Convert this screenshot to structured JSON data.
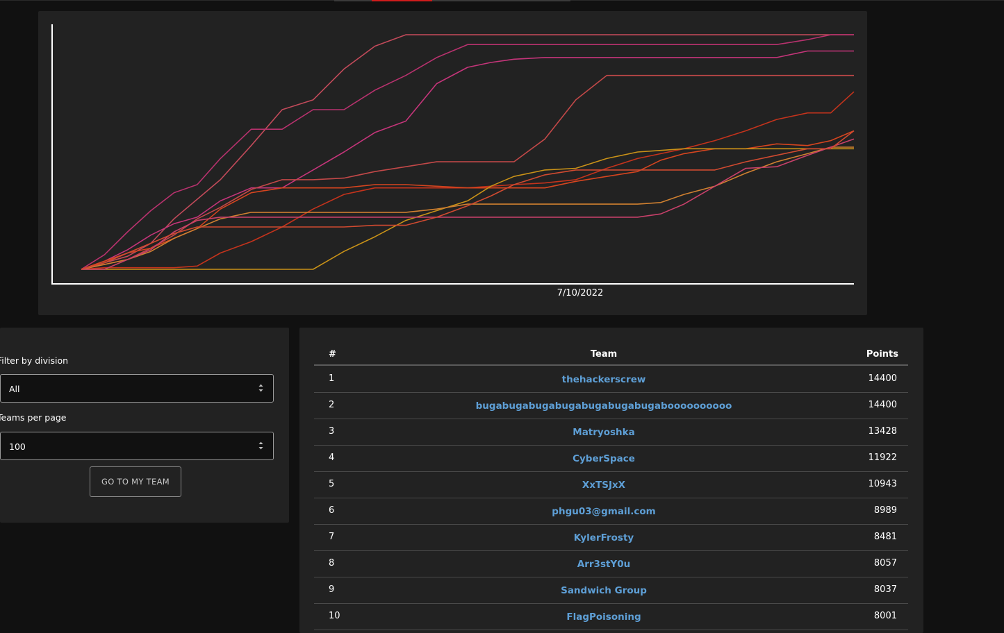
{
  "chart_data": {
    "type": "line",
    "x_tick_labels": [
      "7/10/2022"
    ],
    "series": [
      {
        "color": "#c24a5a",
        "x": [
          0,
          3,
          6,
          9,
          12,
          15,
          18,
          22,
          26,
          30,
          34,
          38,
          42,
          46,
          50,
          53,
          56,
          60,
          64,
          68,
          72,
          75,
          78,
          82,
          86,
          90,
          94,
          97,
          100
        ],
        "y": [
          0,
          0.4,
          0.8,
          1.6,
          3.1,
          4.3,
          5.5,
          7.6,
          9.8,
          10.4,
          12.3,
          13.7,
          14.4,
          14.4,
          14.4,
          14.4,
          14.4,
          14.4,
          14.4,
          14.4,
          14.4,
          14.4,
          14.4,
          14.4,
          14.4,
          14.4,
          14.4,
          14.4,
          14.4
        ]
      },
      {
        "color": "#b8326e",
        "x": [
          0,
          3,
          6,
          9,
          12,
          15,
          18,
          22,
          26,
          30,
          34,
          38,
          42,
          46,
          50,
          53,
          56,
          60,
          64,
          68,
          72,
          75,
          78,
          82,
          86,
          90,
          94,
          97,
          100
        ],
        "y": [
          0,
          0.9,
          2.3,
          3.6,
          4.7,
          5.2,
          6.8,
          8.6,
          8.6,
          9.8,
          9.8,
          11.0,
          11.9,
          13.0,
          13.8,
          13.8,
          13.8,
          13.8,
          13.8,
          13.8,
          13.8,
          13.8,
          13.8,
          13.8,
          13.8,
          13.8,
          14.1,
          14.4,
          14.4
        ]
      },
      {
        "color": "#c5357a",
        "x": [
          0,
          3,
          6,
          9,
          12,
          15,
          18,
          22,
          26,
          30,
          34,
          38,
          42,
          46,
          50,
          53,
          56,
          60,
          64,
          68,
          72,
          75,
          78,
          82,
          86,
          90,
          94,
          97,
          100
        ],
        "y": [
          0,
          0.5,
          1.2,
          2.1,
          2.8,
          3.2,
          4.2,
          5.0,
          5.0,
          6.1,
          7.2,
          8.4,
          9.1,
          11.4,
          12.4,
          12.7,
          12.9,
          13.0,
          13.0,
          13.0,
          13.0,
          13.0,
          13.0,
          13.0,
          13.0,
          13.0,
          13.4,
          13.4,
          13.4
        ]
      },
      {
        "color": "#c24848",
        "x": [
          0,
          3,
          6,
          9,
          12,
          15,
          18,
          22,
          26,
          30,
          34,
          38,
          42,
          46,
          50,
          53,
          56,
          60,
          64,
          68,
          72,
          75,
          78,
          82,
          86,
          90,
          94,
          97,
          100
        ],
        "y": [
          0,
          0.3,
          0.6,
          1.3,
          2.1,
          3.1,
          3.8,
          4.9,
          5.5,
          5.5,
          5.6,
          6.0,
          6.3,
          6.6,
          6.6,
          6.6,
          6.6,
          8.0,
          10.4,
          11.9,
          11.9,
          11.9,
          11.9,
          11.9,
          11.9,
          11.9,
          11.9,
          11.9,
          11.9
        ]
      },
      {
        "color": "#c4331c",
        "x": [
          0,
          3,
          6,
          9,
          12,
          15,
          18,
          22,
          26,
          30,
          34,
          38,
          42,
          46,
          50,
          53,
          56,
          60,
          64,
          68,
          72,
          75,
          78,
          82,
          86,
          90,
          94,
          97,
          100
        ],
        "y": [
          0,
          0.1,
          0.1,
          0.1,
          0.1,
          0.2,
          1.0,
          1.7,
          2.6,
          3.7,
          4.6,
          5.0,
          5.0,
          5.0,
          5.0,
          5.1,
          5.2,
          5.3,
          5.5,
          6.2,
          6.8,
          7.1,
          7.4,
          7.9,
          8.5,
          9.2,
          9.6,
          9.6,
          10.9
        ]
      },
      {
        "color": "#d6451f",
        "x": [
          0,
          3,
          6,
          9,
          12,
          15,
          18,
          22,
          26,
          30,
          34,
          38,
          42,
          46,
          50,
          53,
          56,
          60,
          64,
          68,
          72,
          75,
          78,
          82,
          86,
          90,
          94,
          97,
          100
        ],
        "y": [
          0,
          0.5,
          1.0,
          1.3,
          1.9,
          2.5,
          3.7,
          4.7,
          5.0,
          5.0,
          5.0,
          5.2,
          5.2,
          5.1,
          5.0,
          5.0,
          5.0,
          5.0,
          5.4,
          5.7,
          6.0,
          6.7,
          7.1,
          7.4,
          7.4,
          7.7,
          7.6,
          7.9,
          8.5
        ]
      },
      {
        "color": "#c99218",
        "x": [
          0,
          3,
          6,
          9,
          12,
          15,
          18,
          22,
          26,
          30,
          34,
          38,
          42,
          46,
          50,
          53,
          56,
          60,
          64,
          68,
          72,
          75,
          78,
          82,
          86,
          90,
          94,
          97,
          100
        ],
        "y": [
          0,
          0,
          0,
          0,
          0,
          0,
          0,
          0,
          0,
          0,
          1.1,
          2.0,
          3.0,
          3.6,
          4.2,
          5.1,
          5.7,
          6.1,
          6.2,
          6.8,
          7.2,
          7.3,
          7.4,
          7.4,
          7.4,
          7.4,
          7.4,
          7.4,
          7.4
        ]
      },
      {
        "color": "#d08030",
        "x": [
          0,
          3,
          6,
          9,
          12,
          15,
          18,
          22,
          26,
          30,
          34,
          38,
          42,
          46,
          50,
          53,
          56,
          60,
          64,
          68,
          72,
          75,
          78,
          82,
          86,
          90,
          94,
          97,
          100
        ],
        "y": [
          0,
          0.3,
          0.6,
          1.1,
          1.9,
          2.5,
          3.1,
          3.5,
          3.5,
          3.5,
          3.5,
          3.5,
          3.5,
          3.7,
          4.0,
          4.0,
          4.0,
          4.0,
          4.0,
          4.0,
          4.0,
          4.1,
          4.6,
          5.1,
          5.9,
          6.6,
          7.1,
          7.5,
          7.5
        ]
      },
      {
        "color": "#c8406a",
        "x": [
          0,
          3,
          6,
          9,
          12,
          15,
          18,
          22,
          26,
          30,
          34,
          38,
          42,
          46,
          50,
          53,
          56,
          60,
          64,
          68,
          72,
          75,
          78,
          82,
          86,
          90,
          94,
          97,
          100
        ],
        "y": [
          0,
          0,
          0.6,
          1.2,
          2.3,
          3.0,
          3.2,
          3.2,
          3.2,
          3.2,
          3.2,
          3.2,
          3.2,
          3.2,
          3.2,
          3.2,
          3.2,
          3.2,
          3.2,
          3.2,
          3.2,
          3.4,
          4.0,
          5.1,
          6.2,
          6.3,
          7.0,
          7.5,
          8.0
        ]
      },
      {
        "color": "#d04a30",
        "x": [
          0,
          3,
          6,
          9,
          12,
          15,
          18,
          22,
          26,
          30,
          34,
          38,
          42,
          46,
          50,
          53,
          56,
          60,
          64,
          68,
          72,
          75,
          78,
          82,
          86,
          90,
          94,
          97,
          100
        ],
        "y": [
          0,
          0.4,
          1.0,
          1.6,
          2.2,
          2.6,
          2.6,
          2.6,
          2.6,
          2.6,
          2.6,
          2.7,
          2.7,
          3.2,
          3.9,
          4.5,
          5.2,
          5.8,
          6.1,
          6.1,
          6.1,
          6.1,
          6.1,
          6.1,
          6.6,
          7.0,
          7.4,
          7.4,
          8.5
        ]
      }
    ],
    "ylim": [
      0,
      15
    ],
    "grid": false,
    "legend": "none"
  },
  "filters": {
    "division_label": "Filter by division",
    "division_value": "All",
    "per_page_label": "Teams per page",
    "per_page_value": "100",
    "go_button": "GO TO MY TEAM"
  },
  "table": {
    "headers": {
      "rank": "#",
      "team": "Team",
      "points": "Points"
    },
    "rows": [
      {
        "rank": "1",
        "team": "thehackerscrew",
        "points": "14400"
      },
      {
        "rank": "2",
        "team": "bugabugabugabugabugabugabugaboooooooooo",
        "points": "14400"
      },
      {
        "rank": "3",
        "team": "Matryoshka",
        "points": "13428"
      },
      {
        "rank": "4",
        "team": "CyberSpace",
        "points": "11922"
      },
      {
        "rank": "5",
        "team": "XxTSJxX",
        "points": "10943"
      },
      {
        "rank": "6",
        "team": "phgu03@gmail.com",
        "points": "8989"
      },
      {
        "rank": "7",
        "team": "KylerFrosty",
        "points": "8481"
      },
      {
        "rank": "8",
        "team": "Arr3stY0u",
        "points": "8057"
      },
      {
        "rank": "9",
        "team": "Sandwich Group",
        "points": "8037"
      },
      {
        "rank": "10",
        "team": "FlagPoisoning",
        "points": "8001"
      }
    ]
  }
}
